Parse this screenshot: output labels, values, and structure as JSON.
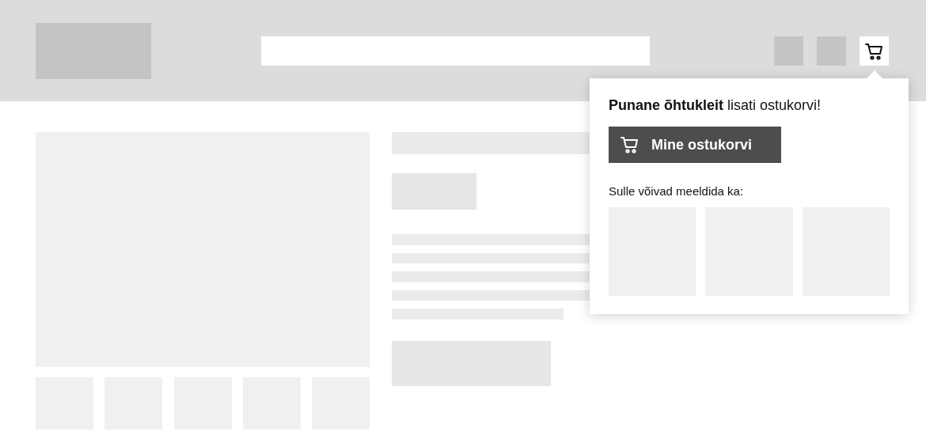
{
  "cart_popup": {
    "message": "**Punane õhtukleit** lisati ostukorvi!",
    "button": "Mine ostukorvi",
    "recommendations_label": "Sulle võivad meeldida ka:"
  }
}
